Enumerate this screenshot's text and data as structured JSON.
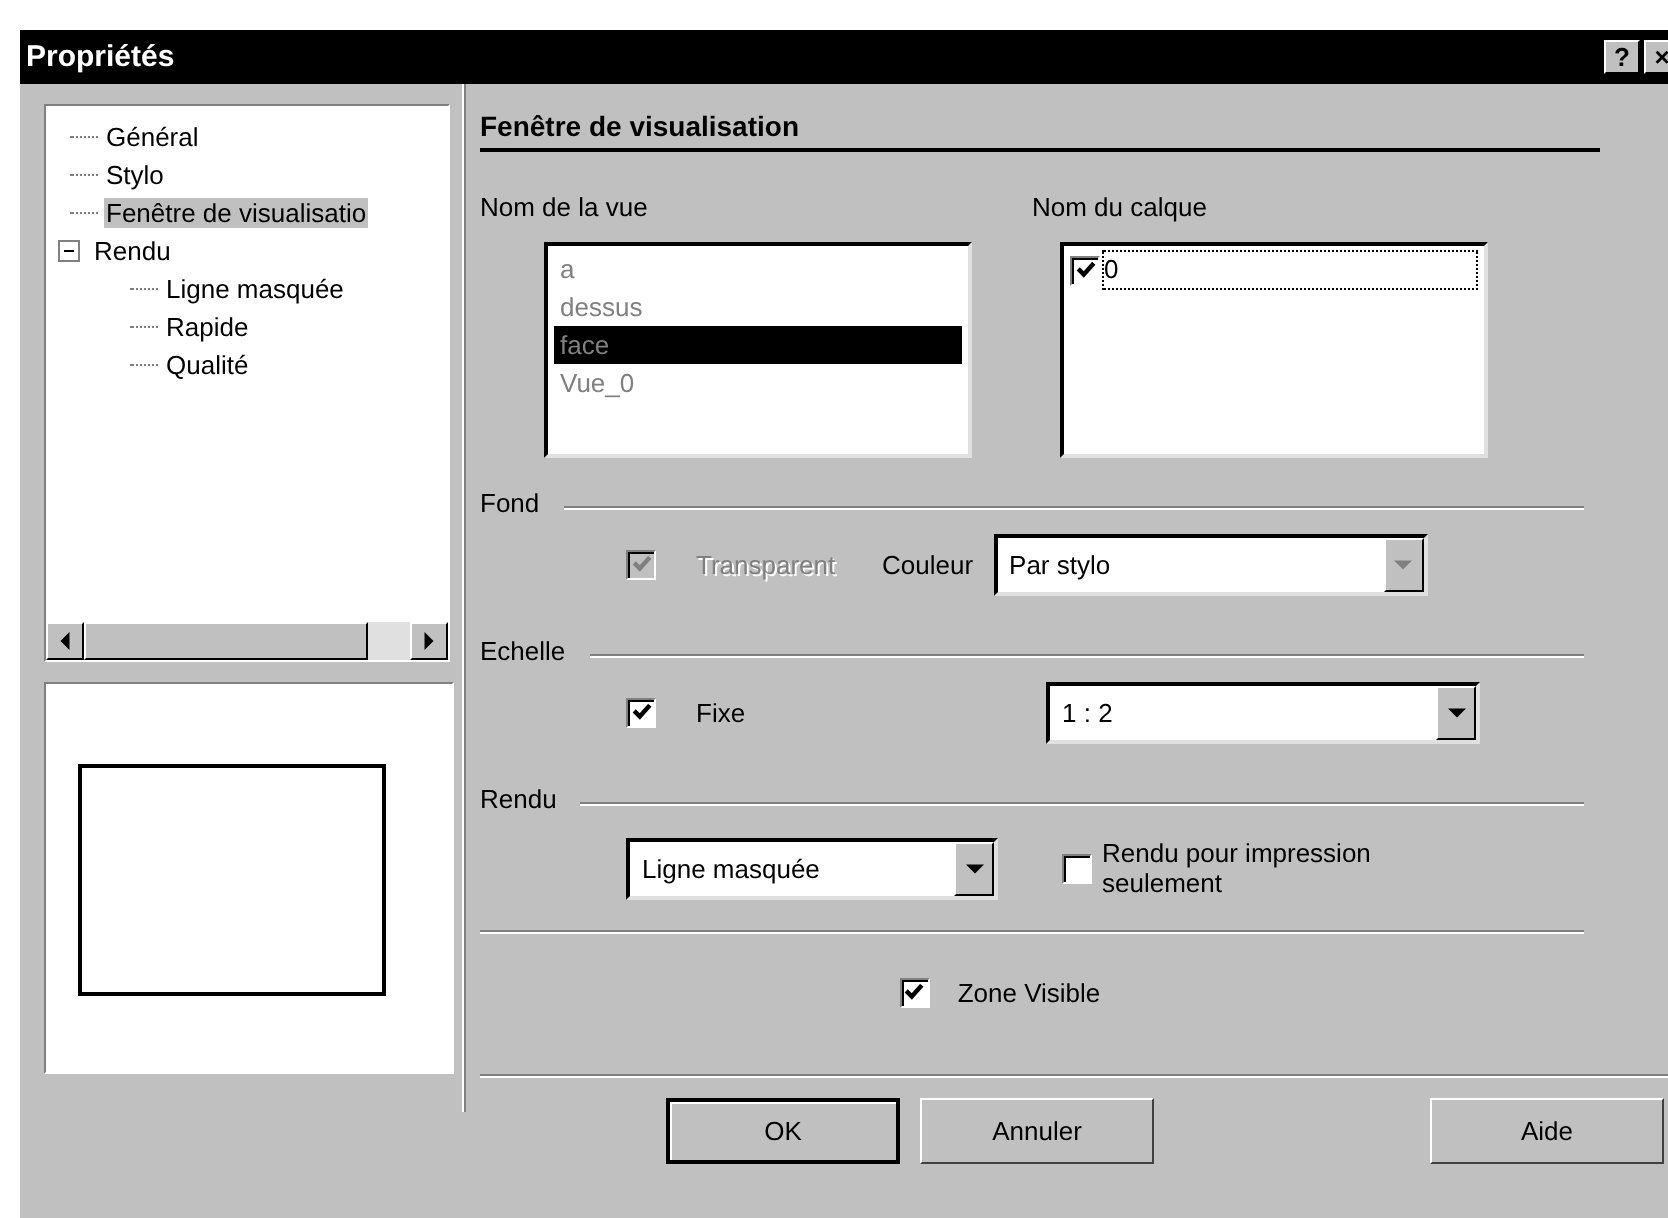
{
  "window": {
    "title": "Propriétés",
    "help_button": "?",
    "close_button": "×"
  },
  "tree": {
    "items": [
      {
        "label": "Général",
        "selected": false
      },
      {
        "label": "Stylo",
        "selected": false
      },
      {
        "label": "Fenêtre de visualisatio",
        "selected": true
      },
      {
        "label": "Rendu",
        "selected": false,
        "expanded": true,
        "children": [
          {
            "label": "Ligne masquée",
            "selected": false
          },
          {
            "label": "Rapide",
            "selected": false
          },
          {
            "label": "Qualité",
            "selected": false
          }
        ]
      }
    ]
  },
  "section_title": "Fenêtre de visualisation",
  "view_list": {
    "label": "Nom de la vue",
    "disabled": true,
    "items": [
      {
        "label": "a",
        "selected": false
      },
      {
        "label": "dessus",
        "selected": false
      },
      {
        "label": "face",
        "selected": true
      },
      {
        "label": "Vue_0",
        "selected": false
      }
    ]
  },
  "layer_list": {
    "label": "Nom du calque",
    "items": [
      {
        "label": "0",
        "checked": true,
        "selected": true
      }
    ]
  },
  "fond": {
    "label": "Fond",
    "transparent": {
      "label": "Transparent",
      "checked": true,
      "disabled": true
    },
    "color_label": "Couleur",
    "color_select": {
      "value": "Par stylo",
      "disabled": true
    }
  },
  "echelle": {
    "label": "Echelle",
    "fixed": {
      "label": "Fixe",
      "checked": true,
      "disabled": false
    },
    "scale_select": {
      "value": "1 : 2",
      "disabled": false
    }
  },
  "rendu": {
    "label": "Rendu",
    "mode_select": {
      "value": "Ligne masquée",
      "disabled": false
    },
    "print_only": {
      "label": "Rendu pour impression seulement",
      "checked": false,
      "disabled": false
    }
  },
  "zone_visible": {
    "label": "Zone Visible",
    "checked": true,
    "disabled": false
  },
  "buttons": [
    {
      "label": "OK",
      "default": true
    },
    {
      "label": "Annuler",
      "default": false
    },
    {
      "label": "Aide",
      "default": false
    }
  ]
}
